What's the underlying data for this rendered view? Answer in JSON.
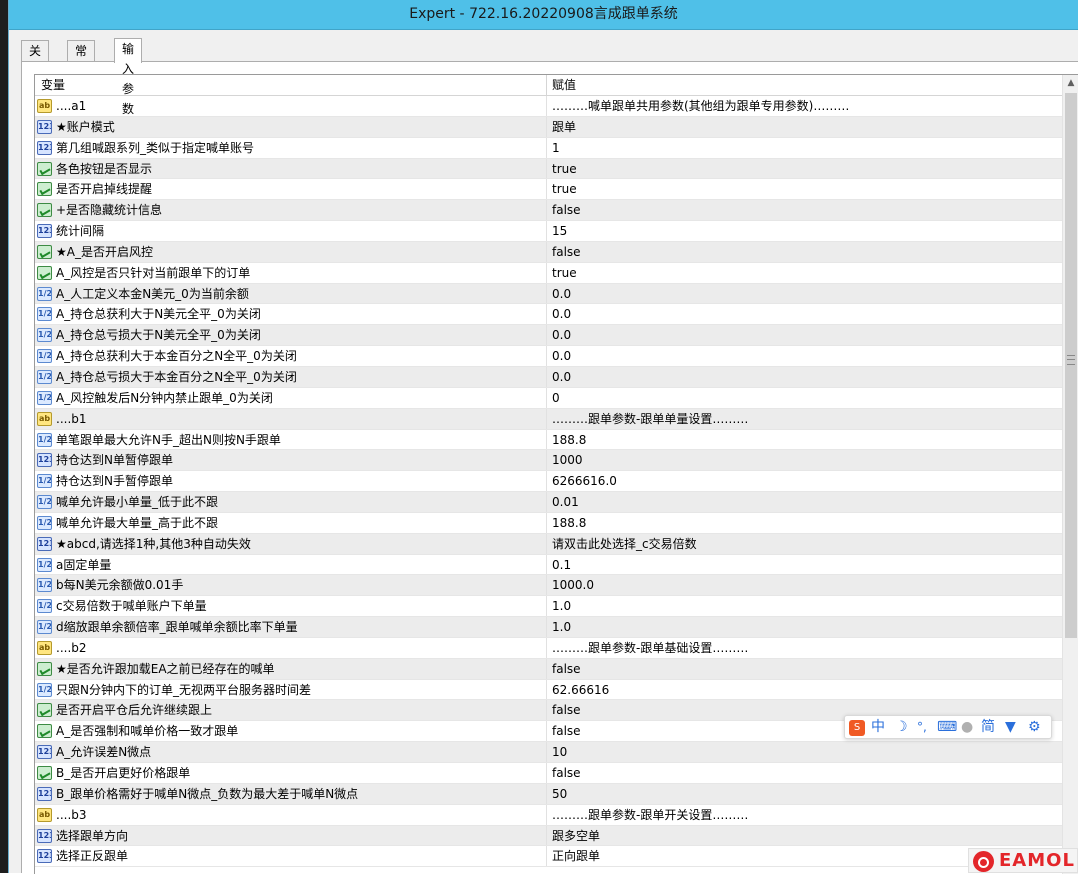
{
  "window": {
    "title": "Expert - 722.16.20220908言成跟单系统"
  },
  "tabs": [
    {
      "label": "关于",
      "active": false
    },
    {
      "label": "常用",
      "active": false
    },
    {
      "label": "输入参数",
      "active": true
    }
  ],
  "grid": {
    "col_variable": "变量",
    "col_value": "赋值",
    "rows": [
      {
        "type": "string",
        "icon": "string-type-icon",
        "name": "....a1",
        "value": "………喊单跟单共用参数(其他组为跟单专用参数)………"
      },
      {
        "type": "int",
        "icon": "enum-type-icon",
        "name": "★账户模式",
        "value": "跟单"
      },
      {
        "type": "int",
        "icon": "int-type-icon",
        "name": "第几组喊跟系列_类似于指定喊单账号",
        "value": "1"
      },
      {
        "type": "bool",
        "icon": "bool-type-icon",
        "name": "各色按钮是否显示",
        "value": "true"
      },
      {
        "type": "bool",
        "icon": "bool-type-icon",
        "name": "是否开启掉线提醒",
        "value": "true"
      },
      {
        "type": "bool",
        "icon": "bool-type-icon",
        "name": "+是否隐藏统计信息",
        "value": "false"
      },
      {
        "type": "int",
        "icon": "int-type-icon",
        "name": "统计间隔",
        "value": "15"
      },
      {
        "type": "bool",
        "icon": "bool-type-icon",
        "name": "★A_是否开启风控",
        "value": "false"
      },
      {
        "type": "bool",
        "icon": "bool-type-icon",
        "name": "A_风控是否只针对当前跟单下的订单",
        "value": "true"
      },
      {
        "type": "double",
        "icon": "double-type-icon",
        "name": "A_人工定义本金N美元_0为当前余额",
        "value": "0.0"
      },
      {
        "type": "double",
        "icon": "double-type-icon",
        "name": "A_持仓总获利大于N美元全平_0为关闭",
        "value": "0.0"
      },
      {
        "type": "double",
        "icon": "double-type-icon",
        "name": "A_持仓总亏损大于N美元全平_0为关闭",
        "value": "0.0"
      },
      {
        "type": "double",
        "icon": "double-type-icon",
        "name": "A_持仓总获利大于本金百分之N全平_0为关闭",
        "value": "0.0"
      },
      {
        "type": "double",
        "icon": "double-type-icon",
        "name": "A_持仓总亏损大于本金百分之N全平_0为关闭",
        "value": "0.0"
      },
      {
        "type": "double",
        "icon": "double-type-icon",
        "name": "A_风控触发后N分钟内禁止跟单_0为关闭",
        "value": "0"
      },
      {
        "type": "string",
        "icon": "string-type-icon",
        "name": "....b1",
        "value": "………跟单参数-跟单单量设置………"
      },
      {
        "type": "double",
        "icon": "double-type-icon",
        "name": "单笔跟单最大允许N手_超出N则按N手跟单",
        "value": "188.8"
      },
      {
        "type": "int",
        "icon": "int-type-icon",
        "name": "持仓达到N单暂停跟单",
        "value": "1000"
      },
      {
        "type": "double",
        "icon": "double-type-icon",
        "name": "持仓达到N手暂停跟单",
        "value": "6266616.0"
      },
      {
        "type": "double",
        "icon": "double-type-icon",
        "name": "喊单允许最小单量_低于此不跟",
        "value": "0.01"
      },
      {
        "type": "double",
        "icon": "double-type-icon",
        "name": "喊单允许最大单量_高于此不跟",
        "value": "188.8"
      },
      {
        "type": "int",
        "icon": "enum-type-icon",
        "name": "★abcd,请选择1种,其他3种自动失效",
        "value": "请双击此处选择_c交易倍数"
      },
      {
        "type": "double",
        "icon": "double-type-icon",
        "name": "a固定单量",
        "value": "0.1"
      },
      {
        "type": "double",
        "icon": "double-type-icon",
        "name": "b每N美元余额做0.01手",
        "value": "1000.0"
      },
      {
        "type": "double",
        "icon": "double-type-icon",
        "name": "c交易倍数于喊单账户下单量",
        "value": "1.0"
      },
      {
        "type": "double",
        "icon": "double-type-icon",
        "name": "d缩放跟单余额倍率_跟单喊单余额比率下单量",
        "value": "1.0"
      },
      {
        "type": "string",
        "icon": "string-type-icon",
        "name": "....b2",
        "value": "………跟单参数-跟单基础设置………"
      },
      {
        "type": "bool",
        "icon": "bool-type-icon",
        "name": "★是否允许跟加载EA之前已经存在的喊单",
        "value": "false"
      },
      {
        "type": "double",
        "icon": "double-type-icon",
        "name": "只跟N分钟内下的订单_无视两平台服务器时间差",
        "value": "62.66616"
      },
      {
        "type": "bool",
        "icon": "bool-type-icon",
        "name": "是否开启平仓后允许继续跟上",
        "value": "false"
      },
      {
        "type": "bool",
        "icon": "bool-type-icon",
        "name": "A_是否强制和喊单价格一致才跟单",
        "value": "false"
      },
      {
        "type": "int",
        "icon": "int-type-icon",
        "name": "A_允许误差N微点",
        "value": "10"
      },
      {
        "type": "bool",
        "icon": "bool-type-icon",
        "name": "B_是否开启更好价格跟单",
        "value": "false"
      },
      {
        "type": "int",
        "icon": "int-type-icon",
        "name": "B_跟单价格需好于喊单N微点_负数为最大差于喊单N微点",
        "value": "50"
      },
      {
        "type": "string",
        "icon": "string-type-icon",
        "name": "....b3",
        "value": "………跟单参数-跟单开关设置………"
      },
      {
        "type": "int",
        "icon": "enum-type-icon",
        "name": "选择跟单方向",
        "value": "跟多空单"
      },
      {
        "type": "int",
        "icon": "enum-type-icon",
        "name": "选择正反跟单",
        "value": "正向跟单"
      }
    ]
  },
  "ime_toolbar": {
    "chinese_label": "中",
    "simplified_label": "简"
  },
  "watermark": {
    "text": "EAMOL"
  }
}
